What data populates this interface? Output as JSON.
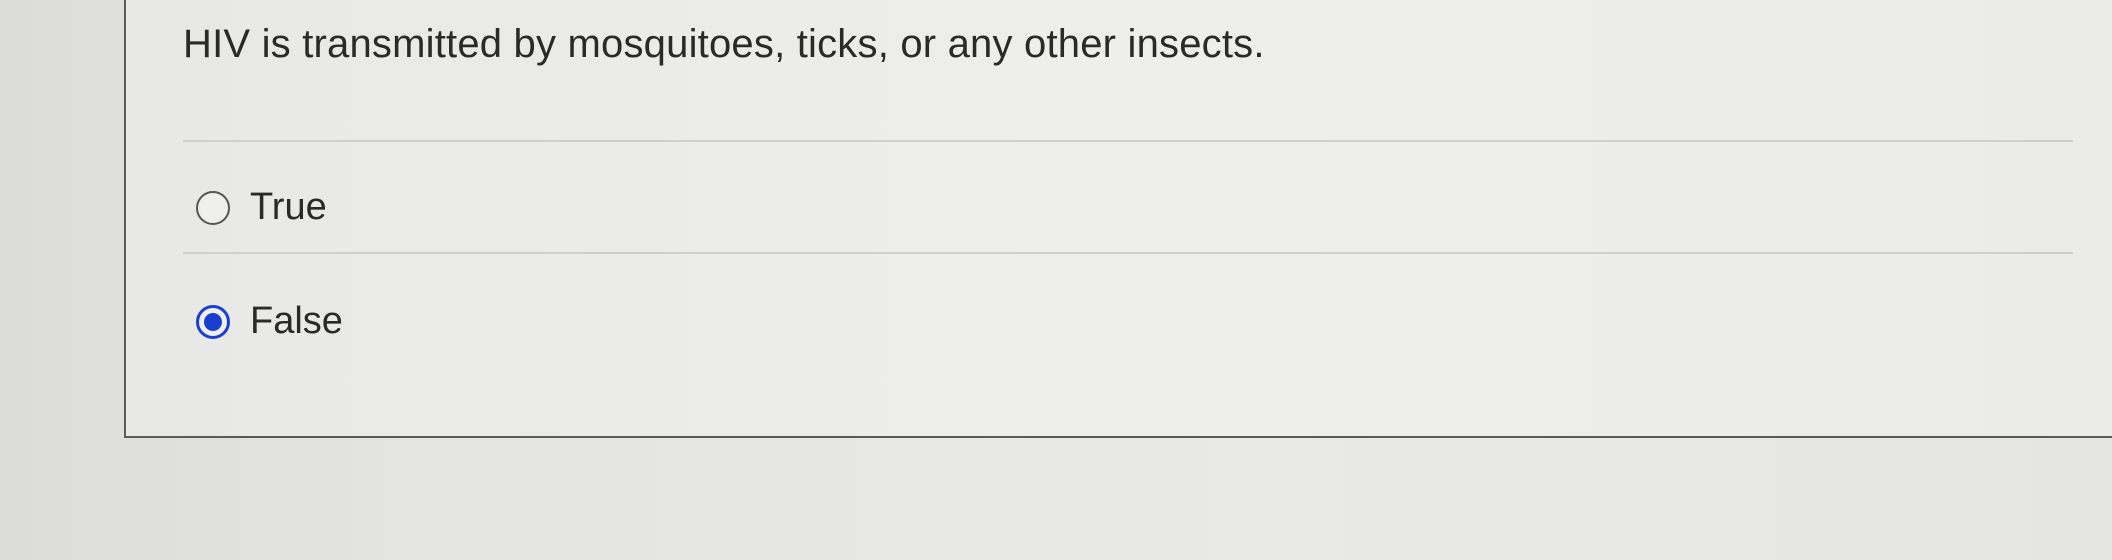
{
  "question": {
    "text": "HIV is transmitted by mosquitoes, ticks, or any other insects."
  },
  "options": [
    {
      "label": "True",
      "selected": false
    },
    {
      "label": "False",
      "selected": true
    }
  ],
  "colors": {
    "selected_radio": "#1a3fcf",
    "text": "#2a2a2a"
  }
}
